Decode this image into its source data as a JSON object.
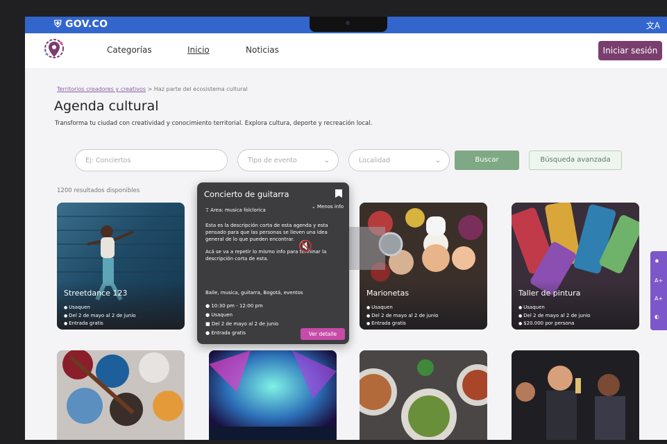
{
  "gov": {
    "logo": "GOV.CO",
    "translate": "文A"
  },
  "nav": {
    "categorias": "Categorías",
    "inicio": "Inicio",
    "noticias": "Noticias",
    "login": "Iniciar sesión"
  },
  "breadcrumb": {
    "part1": "Territorios creadores y creativos",
    "part2": " > Haz parte del ecosistema cultural"
  },
  "page": {
    "title": "Agenda cultural",
    "subtitle": "Transforma tu ciudad con creatividad y conocimiento territorial. Explora cultura, deporte y recreación local."
  },
  "search": {
    "placeholder": "Ej: Conciertos",
    "tipo": "Tipo de evento",
    "localidad": "Localidad",
    "buscar": "Buscar",
    "avanzada": "Búsqueda avanzada"
  },
  "results": "1200 resultados  disponibles",
  "popup": {
    "title": "Concierto de guitarra",
    "area": "Area: musica folclorica",
    "menos": "Menos info",
    "desc1": "Esta es la descripción corta de esta agenda y esta pensado para que las personas se lleven una idea general de lo que pueden encontrar.",
    "desc2": "Acá se va a repetir lo mismo info para terminar la descripción corta de esta.",
    "tags": "Baile, musica, guitarra, Bogotá, eventos",
    "time": "10:30 pm - 12:00 pm",
    "place": "Usaquen",
    "dates": "Del 2 de mayo al 2 de junio",
    "entry": "Entrada gratis",
    "detalle": "Ver detalle"
  },
  "cards": [
    {
      "title": "Streetdance 123",
      "place": "Usaquen",
      "dates": "Del 2 de mayo al 2 de junio",
      "price": "Entrada gratis"
    },
    {
      "title": "Marionetas",
      "place": "Usaquen",
      "dates": "Del 2 de mayo al 2 de junio",
      "price": "Entrada gratis"
    },
    {
      "title": "Taller de pintura",
      "place": "Usaquen",
      "dates": "Del 2 de mayo al 2 de junio",
      "price": "$20.000 por persona"
    }
  ],
  "side": {
    "a1": "A+",
    "a2": "A+"
  }
}
